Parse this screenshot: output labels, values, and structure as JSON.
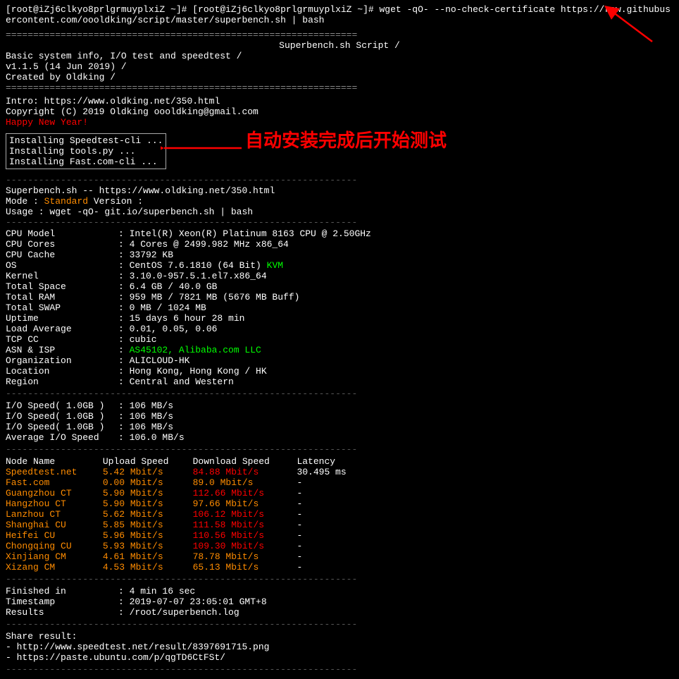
{
  "terminal": {
    "prompt": "[root@iZj6clkyo8prlgrmuyplxiZ ~]# wget -qO- --no-check-certificate https://raw.githubusercontent.com/oooldking/script/master/superbench.sh | bash",
    "banner_divider": "================================================================",
    "banner_title": "Superbench.sh  Script                   /",
    "banner_line1": "     Basic system info, I/O test and speedtest           /",
    "banner_line2": "                 v1.1.5 (14 Jun 2019)                   /",
    "banner_line3": "                 Created by Oldking                     /",
    "intro_line1": "Intro: https://www.oldking.net/350.html",
    "intro_line2": "Copyright (C) 2019 Oldking oooldking@gmail.com",
    "happy_new_year": "Happy New Year!",
    "install_lines": [
      "Installing Speedtest-cli ...",
      "Installing tools.py ...",
      "Installing Fast.com-cli ..."
    ],
    "chinese_annotation": "自动安装完成后开始测试",
    "superbench_url": "Superbench.sh -- https://www.oldking.net/350.html",
    "mode_label": "Mode : ",
    "mode_value": "Standard",
    "version_label": "Version :",
    "usage": "Usage : wget -qO- git.io/superbench.sh | bash",
    "sysinfo": {
      "cpu_model_label": "CPU Model",
      "cpu_model_val": ": Intel(R) Xeon(R) Platinum 8163 CPU @ 2.50GHz",
      "cpu_cores_label": "CPU Cores",
      "cpu_cores_val": ": 4 Cores @ 2499.982 MHz x86_64",
      "cpu_cache_label": "CPU Cache",
      "cpu_cache_val": ": 33792 KB",
      "os_label": "OS",
      "os_val": ": CentOS 7.6.1810 (64 Bit) KVM",
      "kernel_label": "Kernel",
      "kernel_val": ": 3.10.0-957.5.1.el7.x86_64",
      "total_space_label": "Total Space",
      "total_space_val": ": 6.4 GB / 40.0 GB",
      "total_ram_label": "Total RAM",
      "total_ram_val": ": 959 MB / 7821 MB (5676 MB Buff)",
      "total_swap_label": "Total SWAP",
      "total_swap_val": ": 0 MB / 1024 MB",
      "uptime_label": "Uptime",
      "uptime_val": ": 15 days 6 hour 28 min",
      "load_avg_label": "Load Average",
      "load_avg_val": ": 0.01, 0.05, 0.06",
      "tcp_cc_label": "TCP CC",
      "tcp_cc_val": ": cubic",
      "asn_label": "ASN & ISP",
      "asn_val": ": AS45102, Alibaba.com LLC",
      "org_label": "Organization",
      "org_val": ": ALICLOUD-HK",
      "location_label": "Location",
      "location_val": ": Hong Kong, Hong Kong / HK",
      "region_label": "Region",
      "region_val": ": Central and Western"
    },
    "io_tests": [
      {
        "label": "I/O Speed( 1.0GB )",
        "val": ": 106 MB/s"
      },
      {
        "label": "I/O Speed( 1.0GB )",
        "val": ": 106 MB/s"
      },
      {
        "label": "I/O Speed( 1.0GB )",
        "val": ": 106 MB/s"
      },
      {
        "label": "Average I/O Speed",
        "val": ": 106.0 MB/s"
      }
    ],
    "speed_table": {
      "headers": {
        "node": "Node Name",
        "upload": "Upload Speed",
        "download": "Download Speed",
        "latency": "Latency"
      },
      "rows": [
        {
          "node": "Speedtest.net",
          "upload": "5.42 Mbit/s",
          "download": "84.88 Mbit/s",
          "latency": "30.495 ms",
          "upload_color": "orange",
          "download_color": "orange"
        },
        {
          "node": "Fast.com",
          "upload": "0.00 Mbit/s",
          "download": "89.0 Mbit/s",
          "latency": "-",
          "upload_color": "orange",
          "download_color": "orange"
        },
        {
          "node": "Guangzhou CT",
          "upload": "5.90 Mbit/s",
          "download": "112.66 Mbit/s",
          "latency": "-",
          "upload_color": "orange",
          "download_color": "orange"
        },
        {
          "node": "Hangzhou  CT",
          "upload": "5.90 Mbit/s",
          "download": "97.66 Mbit/s",
          "latency": "-",
          "upload_color": "orange",
          "download_color": "orange"
        },
        {
          "node": "Lanzhou   CT",
          "upload": "5.62 Mbit/s",
          "download": "106.12 Mbit/s",
          "latency": "-",
          "upload_color": "orange",
          "download_color": "orange"
        },
        {
          "node": "Shanghai  CU",
          "upload": "5.85 Mbit/s",
          "download": "111.58 Mbit/s",
          "latency": "-",
          "upload_color": "orange",
          "download_color": "orange"
        },
        {
          "node": "Heifei    CU",
          "upload": "5.96 Mbit/s",
          "download": "110.56 Mbit/s",
          "latency": "-",
          "upload_color": "orange",
          "download_color": "orange"
        },
        {
          "node": "Chongqing CU",
          "upload": "5.93 Mbit/s",
          "download": "109.30 Mbit/s",
          "latency": "-",
          "upload_color": "orange",
          "download_color": "orange"
        },
        {
          "node": "Xinjiang  CM",
          "upload": "4.61 Mbit/s",
          "download": "78.78 Mbit/s",
          "latency": "-",
          "upload_color": "orange",
          "download_color": "orange"
        },
        {
          "node": "Xizang    CM",
          "upload": "4.53 Mbit/s",
          "download": "65.13 Mbit/s",
          "latency": "-",
          "upload_color": "orange",
          "download_color": "orange"
        }
      ]
    },
    "finished_label": "Finished in",
    "finished_val": ": 4 min 16 sec",
    "timestamp_label": "Timestamp",
    "timestamp_val": ": 2019-07-07 23:05:01 GMT+8",
    "results_label": "Results",
    "results_val": ": /root/superbench.log",
    "share_label": "Share result:",
    "share_link1": "- http://www.speedtest.net/result/8397691715.png",
    "share_link2": "- https://paste.ubuntu.com/p/qgTD6CtFSt/"
  }
}
